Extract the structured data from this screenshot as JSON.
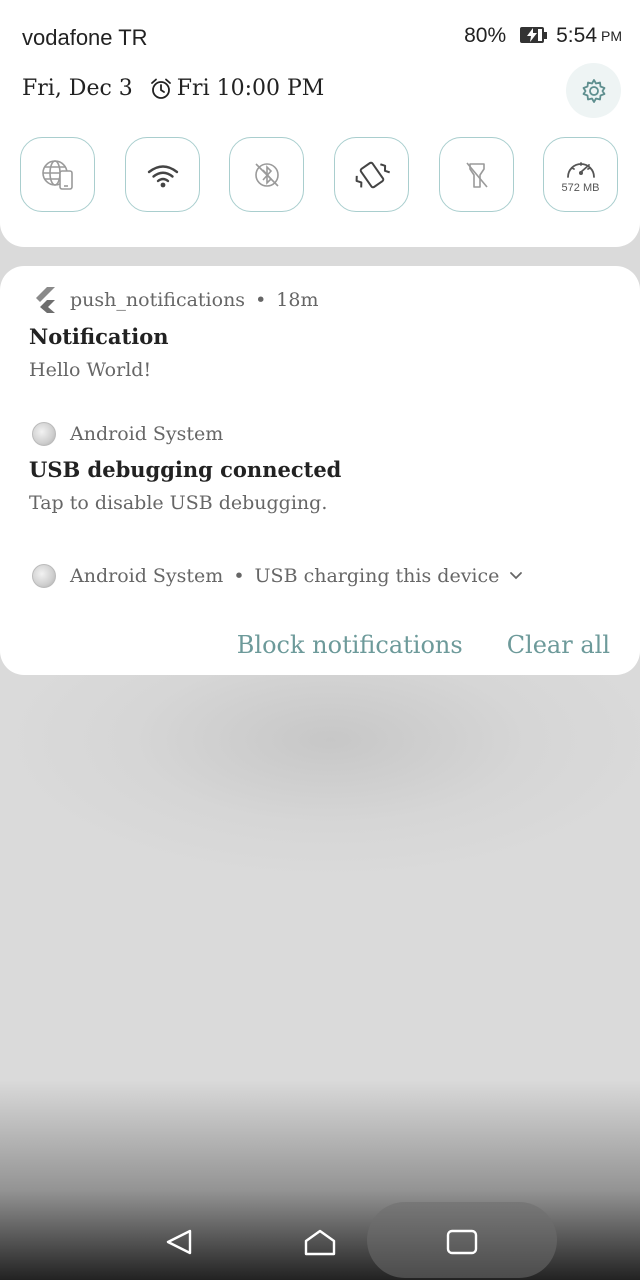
{
  "status_bar": {
    "carrier": "vodafone TR",
    "battery_percent": "80%",
    "battery_level": 0.8,
    "time": "5:54",
    "ampm": "PM"
  },
  "header": {
    "date": "Fri, Dec 3",
    "alarm": "Fri 10:00 PM"
  },
  "quick_tiles": [
    {
      "icon": "mobile-data-icon",
      "label": ""
    },
    {
      "icon": "wifi-icon",
      "label": ""
    },
    {
      "icon": "bluetooth-off-icon",
      "label": ""
    },
    {
      "icon": "vibrate-icon",
      "label": ""
    },
    {
      "icon": "flashlight-off-icon",
      "label": ""
    },
    {
      "icon": "data-usage-icon",
      "label": "572 MB"
    }
  ],
  "notifications": [
    {
      "app": "push_notifications",
      "time": "18m",
      "title": "Notification",
      "text": "Hello World!"
    },
    {
      "app": "Android System",
      "title": "USB debugging connected",
      "text": "Tap to disable USB debugging."
    },
    {
      "app": "Android System",
      "summary": "USB charging this device"
    }
  ],
  "actions": {
    "block": "Block notifications",
    "clear": "Clear all"
  },
  "colors": {
    "accent": "#6d9a9a",
    "tile_border": "#a9cece",
    "background": "#dadada"
  }
}
